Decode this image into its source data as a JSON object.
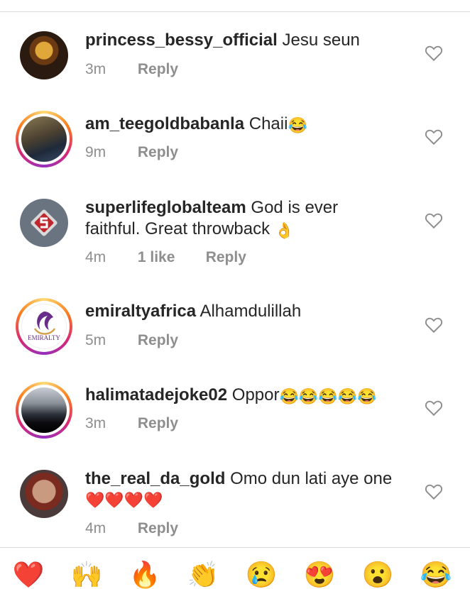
{
  "comments": [
    {
      "username": "princess_bessy_official",
      "text": "Jesu seun",
      "time": "3m",
      "likes": "",
      "reply": "Reply",
      "emoji": "",
      "heart": "heart-outline-icon"
    },
    {
      "username": "am_teegoldbabanla",
      "text": "Chaii",
      "time": "9m",
      "likes": "",
      "reply": "Reply",
      "emoji": "😂",
      "heart": "heart-outline-icon"
    },
    {
      "username": "superlifeglobalteam",
      "text": "God is ever faithful. Great throwback",
      "time": "4m",
      "likes": "1 like",
      "reply": "Reply",
      "emoji": "👌",
      "heart": "heart-outline-icon"
    },
    {
      "username": "emiraltyafrica",
      "text": "Alhamdulillah",
      "time": "5m",
      "likes": "",
      "reply": "Reply",
      "emoji": "",
      "heart": "heart-outline-icon"
    },
    {
      "username": "halimatadejoke02",
      "text": "Oppor",
      "time": "3m",
      "likes": "",
      "reply": "Reply",
      "emoji": "😂😂😂😂😂",
      "heart": "heart-outline-icon"
    },
    {
      "username": "the_real_da_gold",
      "text": "Omo dun lati aye one",
      "time": "4m",
      "likes": "",
      "reply": "Reply",
      "emoji": "❤️❤️❤️❤️",
      "heart": "heart-outline-icon"
    }
  ],
  "avatar_text": {
    "emiralty": "EMIRALTY"
  },
  "quick_reactions": [
    "❤️",
    "🙌",
    "🔥",
    "👏",
    "😢",
    "😍",
    "😮",
    "😂"
  ],
  "colors": {
    "text": "#262626",
    "meta": "#8e8e8e",
    "divider": "#dbdbdb"
  }
}
